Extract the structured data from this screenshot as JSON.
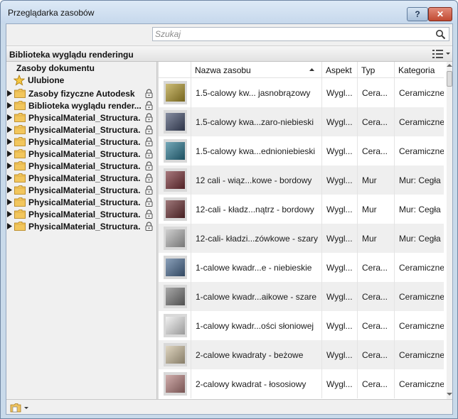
{
  "window": {
    "title": "Przeglądarka zasobów",
    "help_label": "?",
    "close_label": "✕"
  },
  "search": {
    "placeholder": "Szukaj",
    "value": ""
  },
  "library": {
    "title": "Biblioteka wyglądu renderingu"
  },
  "tree": {
    "document_assets": "Zasoby dokumentu",
    "favorites": "Ulubione",
    "items": [
      {
        "label": "Zasoby fizyczne Autodesk",
        "locked": true
      },
      {
        "label": "Biblioteka wyglądu render...",
        "locked": true
      },
      {
        "label": "PhysicalMaterial_Structura...",
        "locked": true
      },
      {
        "label": "PhysicalMaterial_Structura...",
        "locked": true
      },
      {
        "label": "PhysicalMaterial_Structura...",
        "locked": true
      },
      {
        "label": "PhysicalMaterial_Structura...",
        "locked": true
      },
      {
        "label": "PhysicalMaterial_Structura...",
        "locked": true
      },
      {
        "label": "PhysicalMaterial_Structura...",
        "locked": true
      },
      {
        "label": "PhysicalMaterial_Structura...",
        "locked": true
      },
      {
        "label": "PhysicalMaterial_Structura...",
        "locked": true
      },
      {
        "label": "PhysicalMaterial_Structura...",
        "locked": true
      },
      {
        "label": "PhysicalMaterial_Structura...",
        "locked": true
      }
    ]
  },
  "columns": {
    "name": "Nazwa zasobu",
    "aspect": "Aspekt",
    "type": "Typ",
    "category": "Kategoria"
  },
  "rows": [
    {
      "name": "1.5-calowy kw... jasnobrązowy",
      "aspect": "Wygl...",
      "type": "Cera...",
      "category": "Ceramiczne: K",
      "swatch": "#b39a2e"
    },
    {
      "name": "1.5-calowy kwa...zaro-niebieski",
      "aspect": "Wygl...",
      "type": "Cera...",
      "category": "Ceramiczne: K",
      "swatch": "#45506e"
    },
    {
      "name": "1.5-calowy kwa...ednioniebieski",
      "aspect": "Wygl...",
      "type": "Cera...",
      "category": "Ceramiczne: K",
      "swatch": "#2b7a93"
    },
    {
      "name": "12 cali - wiąz...kowe - bordowy",
      "aspect": "Wygl...",
      "type": "Mur",
      "category": "Mur: Cegła",
      "swatch": "#7a3238"
    },
    {
      "name": "12-cali - kładz...nątrz - bordowy",
      "aspect": "Wygl...",
      "type": "Mur",
      "category": "Mur: Cegła",
      "swatch": "#6b3033"
    },
    {
      "name": "12-cali- kładzi...zówkowe - szary",
      "aspect": "Wygl...",
      "type": "Mur",
      "category": "Mur: Cegła",
      "swatch": "#b5b5b5"
    },
    {
      "name": "1-calowe kwadr...e - niebieskie",
      "aspect": "Wygl...",
      "type": "Cera...",
      "category": "Ceramiczne: K",
      "swatch": "#4d6e95"
    },
    {
      "name": "1-calowe kwadr...aikowe - szare",
      "aspect": "Wygl...",
      "type": "Cera...",
      "category": "Ceramiczne: K",
      "swatch": "#7a7a7a"
    },
    {
      "name": "1-calowy kwadr...ości słoniowej",
      "aspect": "Wygl...",
      "type": "Cera...",
      "category": "Ceramiczne: K",
      "swatch": "#ebebeb"
    },
    {
      "name": "2-calowe kwadraty - beżowe",
      "aspect": "Wygl...",
      "type": "Cera...",
      "category": "Ceramiczne: K",
      "swatch": "#cfc0a0"
    },
    {
      "name": "2-calowy kwadrat - łososiowy",
      "aspect": "Wygl...",
      "type": "Cera...",
      "category": "Ceramiczne: K",
      "swatch": "#b88280"
    }
  ]
}
